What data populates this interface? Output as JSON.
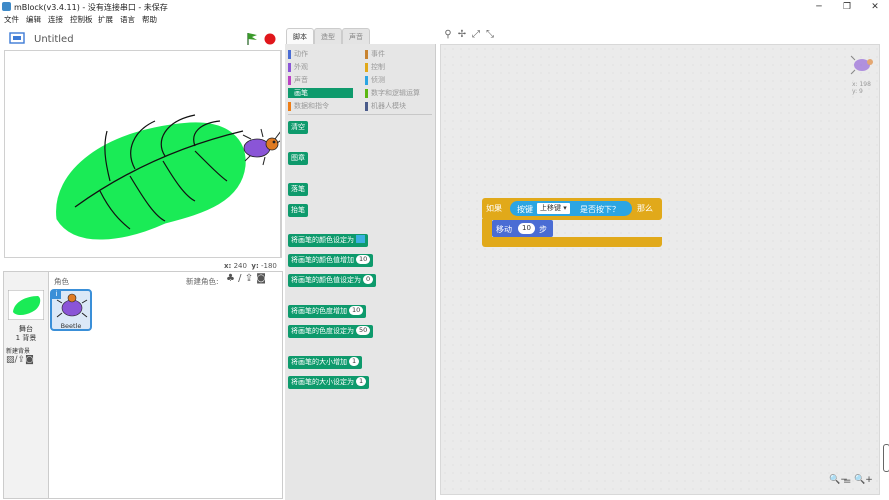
{
  "window": {
    "title": "mBlock(v3.4.11) - 没有连接串口 - 未保存",
    "min": "─",
    "max": "❐",
    "close": "✕"
  },
  "menu": [
    "文件",
    "编辑",
    "连接",
    "控制板",
    "扩展",
    "语言",
    "帮助"
  ],
  "stage": {
    "title": "Untitled",
    "x_label": "x:",
    "x_value": "240",
    "y_label": "y:",
    "y_value": "-180"
  },
  "sprites": {
    "header": "角色",
    "new_sprite_label": "新建角色:",
    "stage_label": "舞台",
    "backdrop_count": "1 背景",
    "new_backdrop_label": "新建背景",
    "items": [
      {
        "name": "Beetle",
        "info": "i"
      }
    ]
  },
  "tabs": [
    "脚本",
    "造型",
    "声音"
  ],
  "categories": [
    {
      "label": "动作",
      "color": "#4a6cd4"
    },
    {
      "label": "事件",
      "color": "#c88330"
    },
    {
      "label": "外观",
      "color": "#8a55d7"
    },
    {
      "label": "控制",
      "color": "#e1a91a"
    },
    {
      "label": "声音",
      "color": "#bb42c3"
    },
    {
      "label": "侦测",
      "color": "#2ca5e2"
    },
    {
      "label": "画笔",
      "color": "#0e9a6c",
      "active": true
    },
    {
      "label": "数字和逻辑运算",
      "color": "#5cb712"
    },
    {
      "label": "数据和指令",
      "color": "#ee7d16"
    },
    {
      "label": "机器人模块",
      "color": "#4a5b8a"
    }
  ],
  "pen_blocks": {
    "clear": "清空",
    "stamp": "图章",
    "pen_down": "落笔",
    "pen_up": "抬笔",
    "set_color": "将画笔的颜色设定为",
    "change_color": "将画笔的颜色值增加",
    "change_color_val": "10",
    "set_color_val": "将画笔的颜色值设定为",
    "set_color_val_v": "0",
    "change_shade": "将画笔的色度增加",
    "change_shade_v": "10",
    "set_shade": "将画笔的色度设定为",
    "set_shade_v": "50",
    "change_size": "将画笔的大小增加",
    "change_size_v": "1",
    "set_size": "将画笔的大小设定为",
    "set_size_v": "1"
  },
  "script": {
    "if_label": "如果",
    "key_label": "按键",
    "key_value": "上移键",
    "pressed_label": "是否按下？",
    "then_label": "那么",
    "move_label": "移动",
    "move_steps": "10",
    "steps_label": "步"
  },
  "sprite_info": {
    "x": "x: 198",
    "y": "y: 9"
  },
  "zoom": {
    "out": "🔍−",
    "reset": "=",
    "in": "🔍+"
  },
  "colors": {
    "pen": "#0e9a6c",
    "control": "#e1a91a",
    "sensing": "#2ca5e2",
    "motion": "#4a6cd4",
    "leaf": "#1aeb56"
  }
}
